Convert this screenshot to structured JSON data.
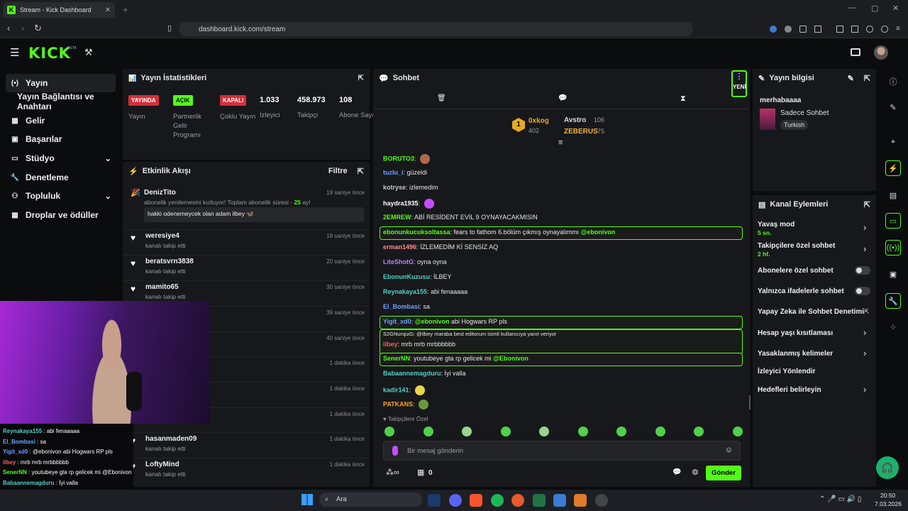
{
  "browser": {
    "tab_title": "Stream - Kick Dashboard",
    "url": "dashboard.kick.com/stream"
  },
  "kick": {
    "logo": "KICK",
    "beta": "BETA"
  },
  "sidebar": {
    "items": [
      {
        "label": "Yayın",
        "icon": "broadcast-icon",
        "active": true
      },
      {
        "label": "Yayın Bağlantısı ve Anahtarı",
        "icon": ""
      },
      {
        "label": "Gelir",
        "icon": "chart-icon"
      },
      {
        "label": "Başarılar",
        "icon": "trophy-icon"
      },
      {
        "label": "Stüdyo",
        "icon": "studio-icon",
        "chevron": true
      },
      {
        "label": "Denetleme",
        "icon": "wrench-icon"
      },
      {
        "label": "Topluluk",
        "icon": "people-icon",
        "chevron": true
      },
      {
        "label": "Droplar ve ödüller",
        "icon": "gift-icon"
      }
    ]
  },
  "stats": {
    "title": "Yayın İstatistikleri",
    "cells": [
      {
        "badge": "YAYINDA",
        "label": "Yayın"
      },
      {
        "badge": "AÇIK",
        "label": "Partnerlik Gelir Programı"
      },
      {
        "badge": "KAPALI",
        "label": "Çoklu Yayın"
      },
      {
        "value": "1.033",
        "label": "İzleyici"
      },
      {
        "value": "458.973",
        "label": "Takipçi"
      },
      {
        "value": "108",
        "label": "Abone Sayısı"
      }
    ]
  },
  "activity": {
    "title": "Etkinlik Akışı",
    "filter": "Filtre",
    "sub_event": {
      "name": "DenizTito",
      "text_before": "abonelik yenilemesini kutluyor! Toplam abonelik süresi - ",
      "months": "25",
      "text_after": " ay!",
      "message": "hakki odenemeycek olan adam ilbey",
      "time": "19 saniye önce"
    },
    "follows": [
      {
        "name": "weresiye4",
        "text": "kanalı takip etti",
        "time": "19 saniye önce"
      },
      {
        "name": "beratsvrn3838",
        "text": "kanalı takip etti",
        "time": "20 saniye önce"
      },
      {
        "name": "mamito65",
        "text": "kanalı takip etti",
        "time": "30 saniye önce"
      },
      {
        "name": "",
        "text": "",
        "time": "39 saniye önce"
      },
      {
        "name": "",
        "text": "",
        "time": "40 saniye önce"
      },
      {
        "name": "",
        "text": "",
        "time": "1 dakika önce"
      },
      {
        "name": "",
        "text": "",
        "time": "1 dakika önce"
      },
      {
        "name": "",
        "text": "",
        "time": "1 dakika önce"
      },
      {
        "name": "hasanmaden09",
        "text": "kanalı takip etti",
        "time": "1 dakika önce"
      },
      {
        "name": "LoftyMind",
        "text": "kanalı takip etti",
        "time": "1 dakika önce"
      }
    ]
  },
  "chat": {
    "title": "Sohbet",
    "new_badge": "YENİ",
    "leaders": [
      {
        "rank": "1",
        "name": "0xkog",
        "count": "402"
      },
      {
        "name": "Avstro",
        "count": "106"
      },
      {
        "name": "ZEBERUS",
        "count": "75"
      }
    ],
    "messages": [
      {
        "user": "BORUTO3",
        "text": "",
        "color": "#53fc18"
      },
      {
        "user": "tuzlu_i",
        "text": "güzeldi",
        "color": "#6aa3ff"
      },
      {
        "user": "kotryse",
        "text": "izlemedim",
        "color": "#c7c7c7"
      },
      {
        "user": "haydra1935",
        "text": "",
        "color": "#ffffff"
      },
      {
        "user": "2EMREW",
        "text": "ABİ RESİDENT EVİL 9 OYNAYACAKMISIN",
        "color": "#53fc18"
      },
      {
        "user": "ebonunkucuksoltassa",
        "text": "fears to fathom 6.bölüm çıkmış oynayalımmı ",
        "mention": "@ebonivon",
        "color": "#53fc18",
        "hl": true
      },
      {
        "user": "erman1496",
        "text": "İZLEMEDİM Kİ SENSİZ AQ",
        "color": "#ff8a8a"
      },
      {
        "user": "LiteShotG",
        "text": "oyna oyna",
        "color": "#c47cff"
      },
      {
        "user": "EbonunKuzusu",
        "text": "İLBEY",
        "color": "#4fd1c5"
      },
      {
        "user": "Reynakaya155",
        "text": "abi fenaaaaa",
        "color": "#4fd1c5"
      },
      {
        "user": "El_Bombasi",
        "text": "sa",
        "color": "#6aa3ff"
      },
      {
        "user": "Yigit_xd0",
        "text": "abi Hogwars RP pls",
        "mention": "@ebonivon",
        "color": "#6aa3ff",
        "hl": true
      },
      {
        "user": "ilbey",
        "text": "mrb mrb mrbbbbbb",
        "reply": "S2GNurquiG: @ilbey maraba best editorum isimli kullanıcıya yanıt veriyor",
        "color": "#ff5a5a",
        "hl": true
      },
      {
        "user": "SenerNN",
        "text": "youtubeye gta rp gelicek mi ",
        "mention": "@Ebonivon",
        "color": "#53fc18",
        "hl": true
      },
      {
        "user": "Babaannemagduru",
        "text": "İyi valla",
        "color": "#4fd1c5"
      },
      {
        "user": "kadir141",
        "text": "",
        "color": "#4fd1c5"
      },
      {
        "user": "PATKANS",
        "text": "",
        "color": "#f5a623"
      }
    ],
    "followers_only": "Takipçilere Özel",
    "input_placeholder": "Bir mesaj gönderin",
    "send": "Gönder",
    "points": "0"
  },
  "info": {
    "title": "Yayın bilgisi",
    "stream_title": "merhabaaaa",
    "category": "Sadece Sohbet",
    "language": "Turkish"
  },
  "actions": {
    "title": "Kanal Eylemleri",
    "slow": {
      "label": "Yavaş mod",
      "value": "5 sn."
    },
    "followers": {
      "label": "Takipçilere özel sohbet",
      "value": "2 hf."
    },
    "subs": "Abonelere özel sohbet",
    "emotes": "Yalnızca ifadelerle sohbet",
    "ai": "Yapay Zeka ile Sohbet Denetimi",
    "age": "Hesap yaşı kısıtlaması",
    "banned": "Yasaklanmış kelimeler",
    "redirect": "İzleyici Yönlendir",
    "goals": "Hedefleri belirleyin"
  },
  "overlay_chat": [
    {
      "user": "Reynakaya155",
      "text": "abi fenaaaaa",
      "color": "#4fd1c5"
    },
    {
      "user": "El_Bombasi",
      "text": "sa",
      "color": "#6aa3ff"
    },
    {
      "user": "Yigit_xd0",
      "text": "@ebonivon abi Hogwars RP pls",
      "color": "#6aa3ff"
    },
    {
      "user": "ilbey",
      "text": "mrb mrb mrbbbbbb",
      "color": "#ff5a5a"
    },
    {
      "user": "SenerNN",
      "text": "youtubeye gta rp gelicek mi @Ebonivon",
      "color": "#53fc18"
    },
    {
      "user": "Babaannemagduru",
      "text": "İyi valla",
      "color": "#4fd1c5"
    },
    {
      "user": "kadir141",
      "text": "",
      "color": "#53fc18"
    },
    {
      "user": "PATKANS",
      "text": "",
      "color": "#f5a623"
    }
  ],
  "taskbar": {
    "search": "Ara",
    "time": "20:50",
    "date": "7.03.2026"
  }
}
